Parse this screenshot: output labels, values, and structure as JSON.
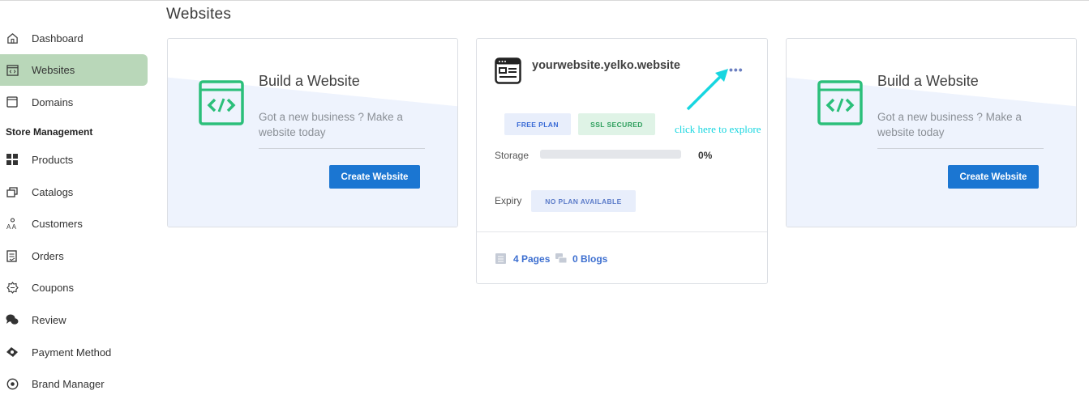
{
  "page": {
    "title": "Websites"
  },
  "sidebar": {
    "items": [
      {
        "label": "Dashboard",
        "icon": "home-icon"
      },
      {
        "label": "Websites",
        "icon": "code-window-icon",
        "active": true
      },
      {
        "label": "Domains",
        "icon": "window-icon"
      }
    ],
    "section_title": "Store Management",
    "store_items": [
      {
        "label": "Products",
        "icon": "grid-icon"
      },
      {
        "label": "Catalogs",
        "icon": "layers-icon"
      },
      {
        "label": "Customers",
        "icon": "users-icon"
      },
      {
        "label": "Orders",
        "icon": "clipboard-icon"
      },
      {
        "label": "Coupons",
        "icon": "coupon-icon"
      },
      {
        "label": "Review",
        "icon": "chat-icon"
      },
      {
        "label": "Payment Method",
        "icon": "payment-icon"
      },
      {
        "label": "Brand Manager",
        "icon": "target-icon"
      }
    ]
  },
  "build_card": {
    "title": "Build a Website",
    "description": "Got a new business ? Make a website today",
    "button": "Create Website",
    "accent": "#2bbf7a"
  },
  "site_card": {
    "name": "yourwebsite.yelko.website",
    "more": "•••",
    "badges": {
      "plan": "FREE PLAN",
      "ssl": "SSL SECURED"
    },
    "storage_label": "Storage",
    "storage_percent": 0,
    "storage_text": "0%",
    "expiry_label": "Expiry",
    "expiry_value": "NO PLAN AVAILABLE",
    "pages": "4 Pages",
    "blogs": "0 Blogs"
  },
  "annotation": {
    "text": "click here to explore",
    "color": "#17d6e0"
  },
  "colors": {
    "primary": "#1b76d2",
    "active_nav": "#b9d7b9",
    "link": "#3d6fd0"
  }
}
